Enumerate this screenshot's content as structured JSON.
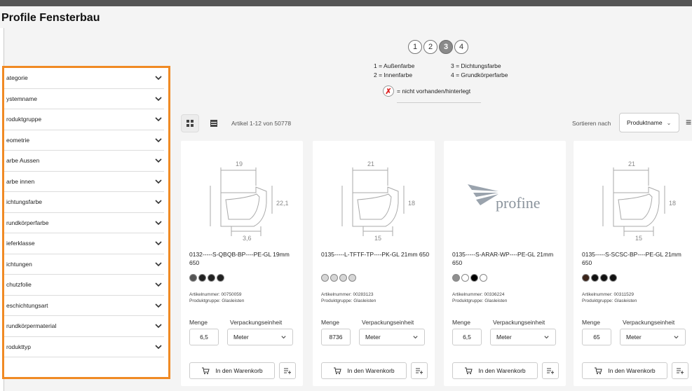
{
  "page": {
    "title": "Profile Fensterbau"
  },
  "filters": [
    {
      "label": "ategorie"
    },
    {
      "label": "ystemname"
    },
    {
      "label": "roduktgruppe"
    },
    {
      "label": "eometrie"
    },
    {
      "label": "arbe Aussen"
    },
    {
      "label": "arbe innen"
    },
    {
      "label": "ichtungsfarbe"
    },
    {
      "label": "rundkörperfarbe"
    },
    {
      "label": "ieferklasse"
    },
    {
      "label": "ichtungen"
    },
    {
      "label": "chutzfolie"
    },
    {
      "label": "eschichtungsart"
    },
    {
      "label": "rundkörpermaterial"
    },
    {
      "label": "rodukttyp"
    }
  ],
  "steps": [
    "1",
    "2",
    "3",
    "4"
  ],
  "active_step": "3",
  "legend": {
    "l1": "1 = Außenfarbe",
    "l2": "3 = Dichtungsfarbe",
    "l3": "2 = Innenfarbe",
    "l4": "4 = Grundkörperfarbe",
    "x_text": "= nicht vorhanden/hinterlegt"
  },
  "toolbar": {
    "article_count": "Artikel 1-12 von 50778",
    "sort_label": "Sortieren nach",
    "sort_value": "Produktname"
  },
  "labels": {
    "menge": "Menge",
    "verpackungseinheit": "Verpackungseinheit",
    "cart": "In den Warenkorb"
  },
  "products": [
    {
      "name": "0132-----S-QBQB-BP----PE-GL 19mm 650",
      "swatches": [
        "#555555",
        "#222222",
        "#222222",
        "#222222"
      ],
      "artikelnummer": "Artikelnummer: 00750059",
      "produktgruppe": "Produktgruppe: Glasleisten",
      "qty": "6,5",
      "unit": "Meter",
      "image": "profile-drawing",
      "dims": [
        "19",
        "22,1",
        "3,6"
      ]
    },
    {
      "name": "0135-----L-TFTF-TP----PK-GL 21mm 650",
      "swatches": [
        "#d6d6d6",
        "#d6d6d6",
        "#d6d6d6",
        "#d6d6d6"
      ],
      "artikelnummer": "Artikelnummer: 00283123",
      "produktgruppe": "Produktgruppe: Glasleisten",
      "qty": "8736",
      "unit": "Meter",
      "image": "profile-drawing",
      "dims": [
        "21",
        "18",
        "15"
      ]
    },
    {
      "name": "0135-----S-ARAR-WP----PE-GL 21mm 650",
      "swatches": [
        "#8f8f8f",
        "#ffffff",
        "#000000",
        "#ffffff"
      ],
      "artikelnummer": "Artikelnummer: 00336224",
      "produktgruppe": "Produktgruppe: Glasleisten",
      "qty": "6,5",
      "unit": "Meter",
      "image": "profine-logo",
      "logo_text": "profine"
    },
    {
      "name": "0135-----S-SCSC-BP----PE-GL 21mm 650",
      "swatches": [
        "#3b241a",
        "#111111",
        "#111111",
        "#111111"
      ],
      "artikelnummer": "Artikelnummer: 00311529",
      "produktgruppe": "Produktgruppe: Glasleisten",
      "qty": "65",
      "unit": "Meter",
      "image": "profile-drawing",
      "dims": [
        "21",
        "18",
        "15"
      ]
    }
  ]
}
